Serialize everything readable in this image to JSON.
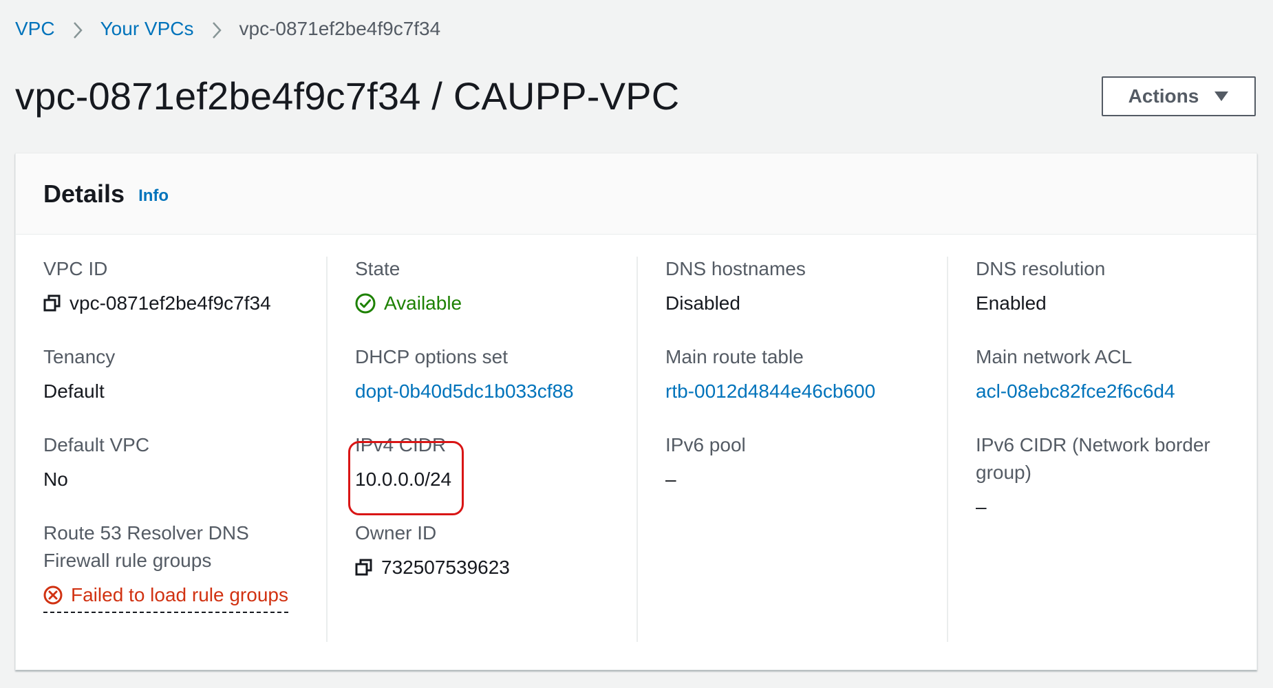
{
  "breadcrumb": {
    "items": [
      "VPC",
      "Your VPCs",
      "vpc-0871ef2be4f9c7f34"
    ]
  },
  "page": {
    "title": "vpc-0871ef2be4f9c7f34 / CAUPP-VPC",
    "actions_label": "Actions"
  },
  "details": {
    "title": "Details",
    "info_label": "Info",
    "vpc_id": {
      "label": "VPC ID",
      "value": "vpc-0871ef2be4f9c7f34"
    },
    "state": {
      "label": "State",
      "value": "Available"
    },
    "dns_hostnames": {
      "label": "DNS hostnames",
      "value": "Disabled"
    },
    "dns_resolution": {
      "label": "DNS resolution",
      "value": "Enabled"
    },
    "tenancy": {
      "label": "Tenancy",
      "value": "Default"
    },
    "dhcp_options": {
      "label": "DHCP options set",
      "value": "dopt-0b40d5dc1b033cf88"
    },
    "main_route_table": {
      "label": "Main route table",
      "value": "rtb-0012d4844e46cb600"
    },
    "main_network_acl": {
      "label": "Main network ACL",
      "value": "acl-08ebc82fce2f6c6d4"
    },
    "default_vpc": {
      "label": "Default VPC",
      "value": "No"
    },
    "ipv4_cidr": {
      "label": "IPv4 CIDR",
      "value": "10.0.0.0/24"
    },
    "ipv6_pool": {
      "label": "IPv6 pool",
      "value": "–"
    },
    "ipv6_cidr": {
      "label_line1": "IPv6 CIDR (Network border",
      "label_line2": "group)",
      "value": "–"
    },
    "route53": {
      "label_line1": "Route 53 Resolver DNS",
      "label_line2": "Firewall rule groups",
      "value": "Failed to load rule groups"
    },
    "owner_id": {
      "label": "Owner ID",
      "value": "732507539623"
    }
  },
  "colors": {
    "link": "#0073bb",
    "success": "#1d8102",
    "error": "#d13212",
    "highlight": "#d91515"
  }
}
